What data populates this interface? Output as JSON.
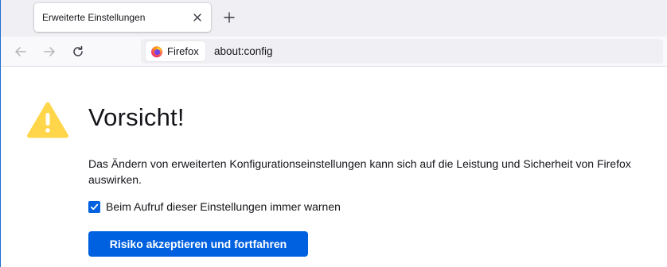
{
  "tabs": [
    {
      "title": "Erweiterte Einstellungen",
      "active": true
    }
  ],
  "toolbar": {
    "identity_label": "Firefox",
    "url": "about:config"
  },
  "warning": {
    "heading": "Vorsicht!",
    "description": "Das Ändern von erweiterten Konfigurationseinstellungen kann sich auf die Leistung und Sicherheit von Firefox auswirken.",
    "checkbox_label": "Beim Aufruf dieser Einstellungen immer warnen",
    "checkbox_checked": true,
    "button_label": "Risiko akzeptieren und fortfahren"
  },
  "icons": {
    "tab_close": "close-icon",
    "new_tab": "plus-icon",
    "back": "arrow-left-icon",
    "forward": "arrow-right-icon",
    "reload": "reload-icon",
    "identity": "firefox-logo-icon",
    "warning": "warning-triangle-icon",
    "checkbox": "checkmark-icon"
  },
  "colors": {
    "accent": "#0061e0",
    "warning_yellow": "#ffd54a",
    "text": "#15141a"
  }
}
